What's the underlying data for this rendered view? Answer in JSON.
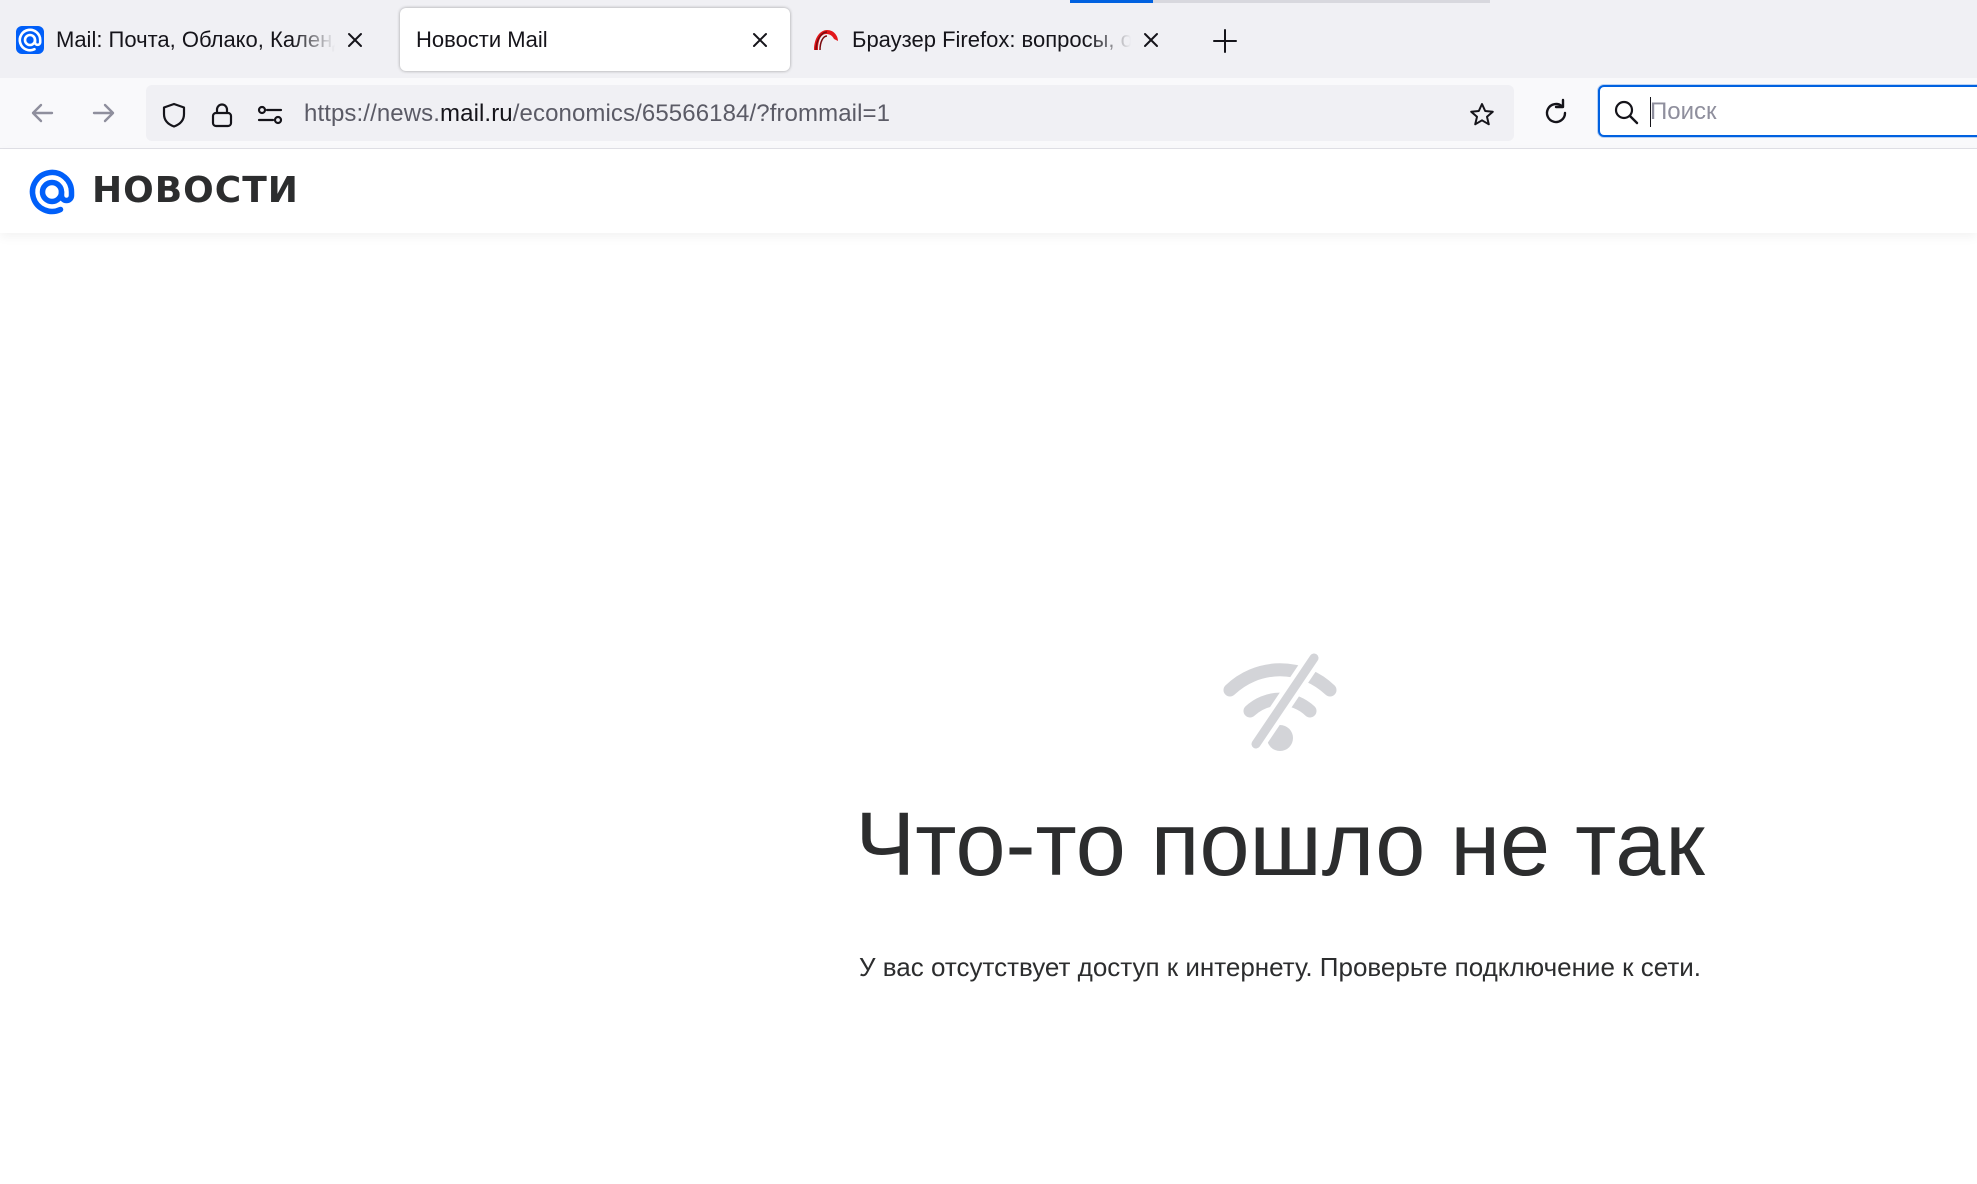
{
  "browser": {
    "tabs": [
      {
        "title": "Mail: Почта, Облако, Календарь",
        "icon": "mail-at-icon",
        "active": false
      },
      {
        "title": "Новости Mail",
        "icon": null,
        "active": true
      },
      {
        "title": "Браузер Firefox: вопросы, ответы",
        "icon": "firefox-help-icon",
        "active": false
      }
    ],
    "url": {
      "prefix": "https://news.",
      "host": "mail.ru",
      "path": "/economics/65566184/?frommail=1"
    },
    "search": {
      "placeholder": "Поиск",
      "value": ""
    },
    "accent_color": "#0061e0"
  },
  "site": {
    "logo_text": "НОВОСТИ",
    "brand_color": "#005ff9"
  },
  "error": {
    "icon": "no-wifi-icon",
    "title": "Что-то пошло не так",
    "message": "У вас отсутствует доступ к интернету. Проверьте подключение к сети."
  }
}
